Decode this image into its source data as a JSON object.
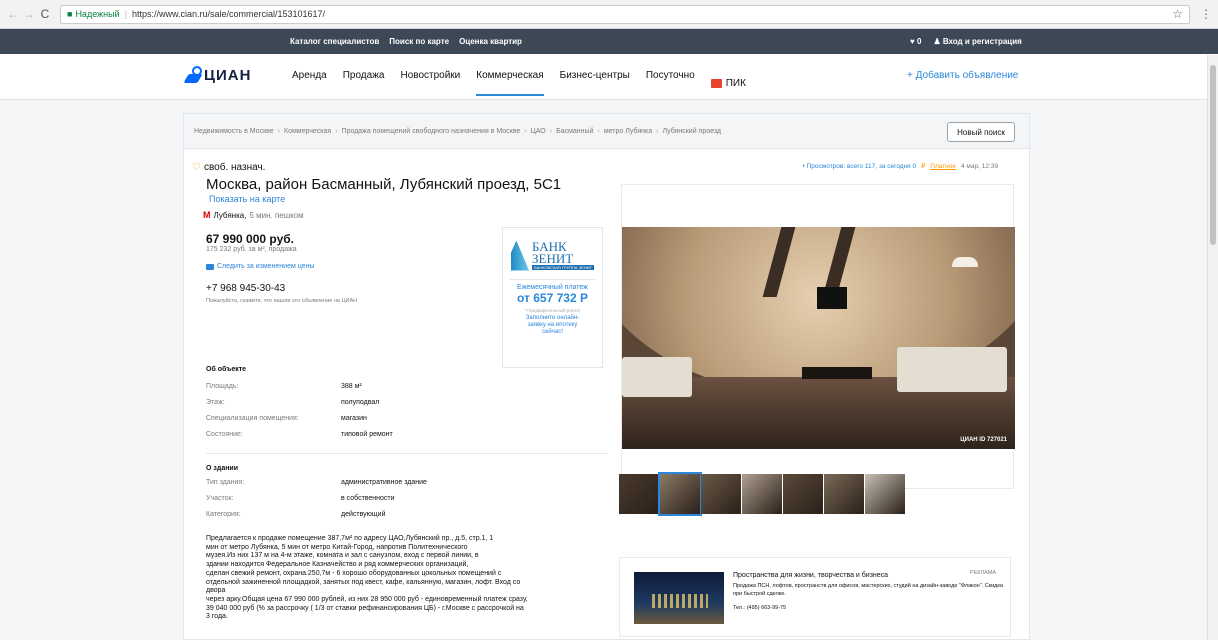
{
  "browser": {
    "secure_label": "Надежный",
    "url": "https://www.cian.ru/sale/commercial/153101617/"
  },
  "topbar": {
    "links": [
      "Каталог специалистов",
      "Поиск по карте",
      "Оценка квартир"
    ],
    "favorites_count": "0",
    "login": "Вход и регистрация"
  },
  "nav": {
    "logo": "ЦИАН",
    "items": [
      "Аренда",
      "Продажа",
      "Новостройки",
      "Коммерческая",
      "Бизнес-центры",
      "Посуточно"
    ],
    "pik": "ПИК",
    "add_ad": "+ Добавить объявление"
  },
  "breadcrumbs": [
    "Недвижимость в Москве",
    "Коммерческая",
    "Продажа помещений свободного назначения в Москве",
    "ЦАО",
    "Басманный",
    "метро Лубянка",
    "Лубянский проезд"
  ],
  "new_search": "Новый поиск",
  "listing": {
    "type": "своб. назнач.",
    "address": "Москва, район Басманный, Лубянский проезд, 5С1",
    "show_map": "Показать на карте",
    "metro_name": "Лубянка,",
    "metro_time": "5 мин. пешком",
    "price": "67 990 000 руб.",
    "price_per": "175 232 руб. за м², продажа",
    "follow": "Следить за изменением цены",
    "phone": "+7 968 945-30-43",
    "phone_note": "Пожалуйста, скажите, что нашли это объявление на ЦИАН",
    "meta_views": "• Просмотров: всего 117, за сегодня 0",
    "meta_paid": "Платное",
    "meta_date": "4 мар, 12:39"
  },
  "bank": {
    "name_line1": "БАНК",
    "name_line2": "ЗЕНИТ",
    "sub": "БАНКОВСКАЯ ГРУППА ЗЕНИТ",
    "monthly": "Ежемесячный платеж",
    "amount": "от 657 732 Р",
    "prelim": "* Предварительный расчет",
    "cta": "Заполните онлайн-заявку на ипотеку сейчас!"
  },
  "about_object": {
    "title": "Об объекте",
    "rows": [
      {
        "k": "Площадь:",
        "v": "388 м²"
      },
      {
        "k": "Этаж:",
        "v": "полуподвал"
      },
      {
        "k": "Специализация помещения:",
        "v": "магазин"
      },
      {
        "k": "Состояние:",
        "v": "типовой ремонт"
      }
    ]
  },
  "about_building": {
    "title": "О здании",
    "rows": [
      {
        "k": "Тип здания:",
        "v": "административное здание"
      },
      {
        "k": "Участок:",
        "v": "в собственности"
      },
      {
        "k": "Категория:",
        "v": "действующий"
      }
    ]
  },
  "description": "Предлагается к продаже помещение 387,7м² по адресу ЦАО,Лубянский пр., д.5, стр.1, 1\nмин от метро Лубянка, 5 мин от метро Китай-Город, напротив Политехнического\nмузея.Из них 137 м на 4-м этаже, комната и зал с санузлом, вход с первой линии, в\nздании находится Федеральное Казначейство и ряд коммерческих организаций,\nсделан свежий ремонт, охрана.250,7м - 6 хорошо оборудованных цокольных помещений с\nотдельной зажиненной площадкой, занятых под квест, кафе, кальянную, магазин, лофт. Вход со\nдвора\nчерез арку.Общая цена 67 990 000 рублей, из них 28 950 000 руб - единовременный платеж сразу,\n39 040 000 руб (% за рассрочку ( 1/3 от ставки рефинансирования ЦБ) - г.Москве с рассрочкой на\n3 года.",
  "photo_watermark": "ЦИАН  ID 727021",
  "thumb_colors": [
    "#4a3a2e",
    "#8a7a66",
    "#6b5a48",
    "#b0a090",
    "#5a4a3a",
    "#7a6a58",
    "#c8c0b4"
  ],
  "ad": {
    "title": "Пространства для жизни, творчества и бизнеса",
    "label": "РЕКЛАМА",
    "text": "Продажа ПСН, лофтов, пространств для офисов, мастерских, студий на дизайн-заводе \"Флакон\". Скидка при быстрой сделке.",
    "tel": "Тел.: (495) 663-99-75"
  }
}
